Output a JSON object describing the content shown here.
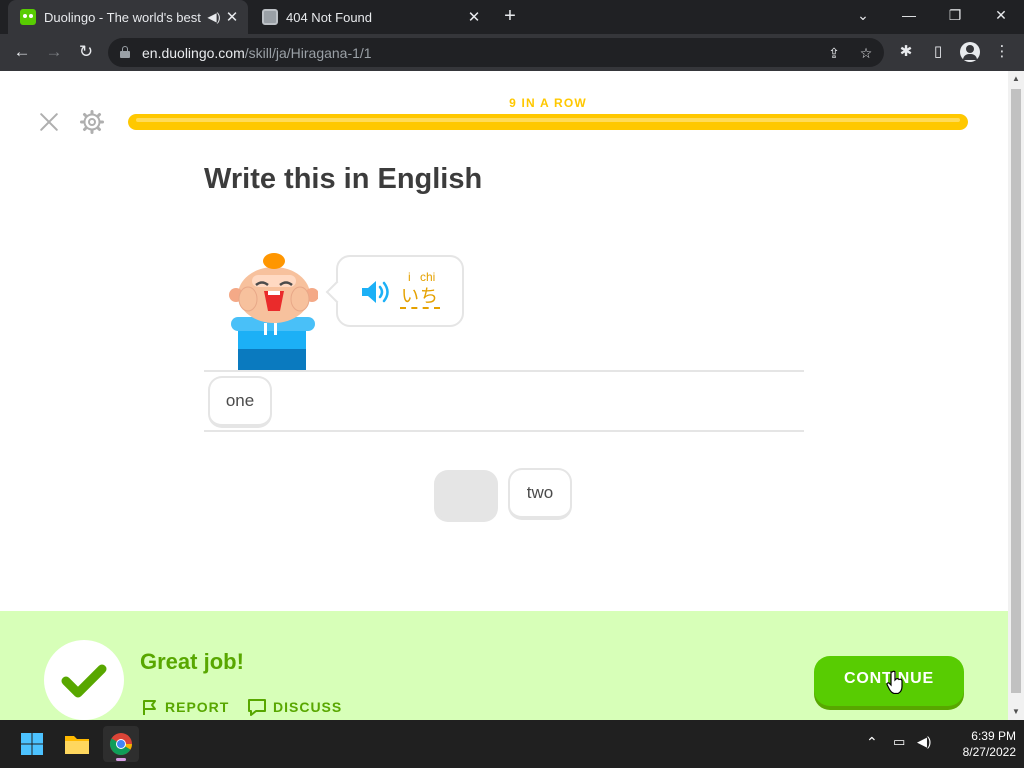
{
  "browser": {
    "tabs": [
      {
        "title": "Duolingo - The world's best",
        "active": true,
        "audio_icon": "speaker-icon"
      },
      {
        "title": "404 Not Found",
        "active": false
      }
    ],
    "new_tab_label": "+",
    "url_host": "en.duolingo.com",
    "url_path": "/skill/ja/Hiragana-1/1"
  },
  "lesson": {
    "streak_label": "9 IN A ROW",
    "progress_fraction": 1.0,
    "prompt": "Write this in English",
    "bubble": {
      "romaji": [
        "i",
        "chi"
      ],
      "kana": [
        "い",
        "ち"
      ]
    },
    "selected_words": [
      "one"
    ],
    "word_bank": [
      "",
      "two"
    ]
  },
  "feedback": {
    "title": "Great job!",
    "report_label": "REPORT",
    "discuss_label": "DISCUSS",
    "continue_label": "CONTINUE"
  },
  "taskbar": {
    "time": "6:39 PM",
    "date": "8/27/2022"
  },
  "colors": {
    "brand_green": "#58cc02",
    "streak_yellow": "#ffc800",
    "feedback_bg": "#d7ffb8",
    "feedback_text": "#58a700"
  }
}
